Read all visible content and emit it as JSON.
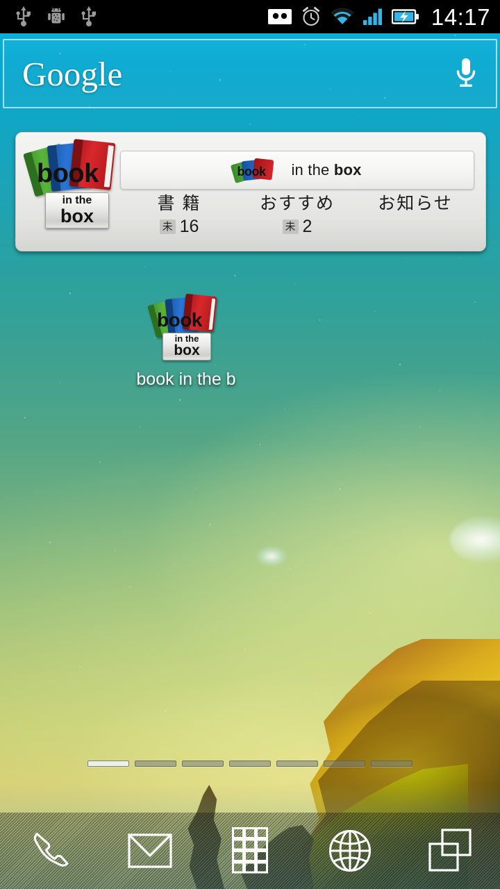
{
  "status_bar": {
    "left_icons": [
      "usb-icon",
      "android-debug-icon",
      "usb-icon"
    ],
    "right_icons": [
      "voicemail-icon",
      "alarm-clock-icon",
      "wifi-icon",
      "cellular-signal-icon",
      "battery-charging-icon"
    ],
    "time": "14:17",
    "background_color": "#000000",
    "accent_color": "#33b5e5"
  },
  "search_widget": {
    "brand": "Google",
    "voice_icon": "microphone-icon",
    "border_color": "#e1f5ff"
  },
  "bitb_widget": {
    "logo_icon": "book-in-the-box-logo",
    "logo_word": "book",
    "logo_plate_top": "in the",
    "logo_plate_bottom": "box",
    "header_text_light": "in the ",
    "header_text_bold": "box",
    "columns": [
      {
        "category": "書 籍",
        "badge": "未",
        "count": "16"
      },
      {
        "category": "おすすめ",
        "badge": "未",
        "count": "2"
      },
      {
        "category": "お知らせ",
        "badge": "",
        "count": ""
      }
    ]
  },
  "app_icon": {
    "label": "book in the b",
    "icon": "book-in-the-box-icon"
  },
  "page_indicator": {
    "total": 7,
    "active_index": 0
  },
  "dock": {
    "items": [
      {
        "name": "phone",
        "icon": "phone-icon"
      },
      {
        "name": "messaging",
        "icon": "envelope-icon"
      },
      {
        "name": "all-apps",
        "icon": "app-grid-icon"
      },
      {
        "name": "browser",
        "icon": "globe-icon"
      },
      {
        "name": "task-switcher",
        "icon": "overlapping-windows-icon"
      }
    ]
  }
}
